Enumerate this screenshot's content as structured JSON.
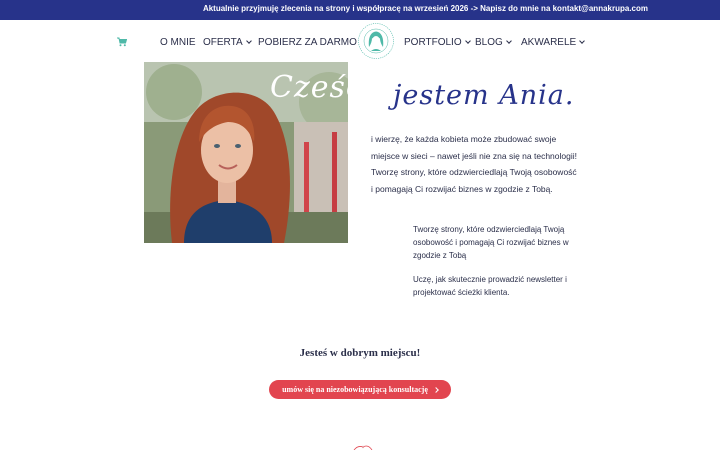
{
  "topbar": {
    "text": "Aktualnie przyjmuję zlecenia na strony i współpracę na wrzesień 2026 -> Napisz do mnie na kontakt@annakrupa.com"
  },
  "nav": {
    "items": [
      {
        "label": "O MNIE"
      },
      {
        "label": "OFERTA"
      },
      {
        "label": "POBIERZ ZA DARMO"
      },
      {
        "label": "PORTFOLIO"
      },
      {
        "label": "BLOG"
      },
      {
        "label": "AKWARELE"
      }
    ]
  },
  "hero": {
    "photo_caption": "Cześć,",
    "headline": "jestem Ania.",
    "intro": "i wierzę, że każda kobieta może zbudować swoje miejsce w sieci – nawet jeśli nie zna się na technologii! Tworzę strony, które odzwierciedlają Twoją osobowość i pomagają Ci rozwijać biznes w zgodzie z Tobą.",
    "point1": "Tworzę strony, które odzwierciedlają Twoją osobowość i pomagają Ci rozwijać biznes w zgodzie z Tobą",
    "point2": "Uczę, jak skutecznie prowadzić newsletter i projektować ścieżki klienta."
  },
  "cta_section": {
    "heading": "Jesteś w dobrym miejscu!",
    "button": "umów się na niezobowiązującą konsultację"
  },
  "colors": {
    "topbar": "#27338a",
    "accent": "#e2454f",
    "text": "#2b2f4a",
    "logo": "#4fb9a8"
  },
  "icons": [
    "cart-icon",
    "chevron-down-icon",
    "chevron-right-icon"
  ]
}
